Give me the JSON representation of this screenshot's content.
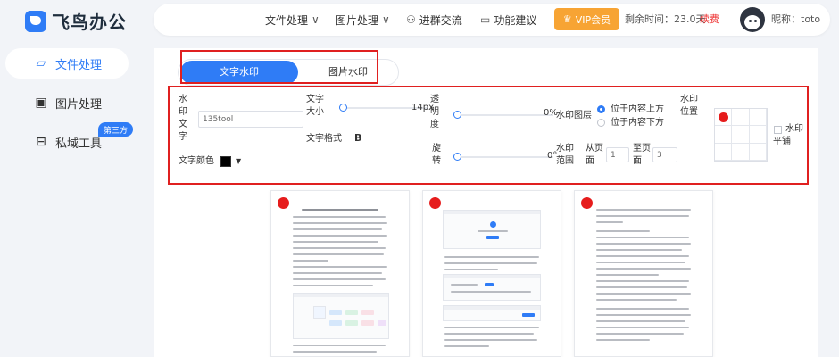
{
  "logo": {
    "text": "飞鸟办公"
  },
  "nav": {
    "file": "文件处理",
    "image": "图片处理",
    "group": "进群交流",
    "feedback": "功能建议",
    "vip": "VIP会员",
    "remain": "剩余时间：23.0天",
    "renew": "续费",
    "nickname": "昵称：toto"
  },
  "sidebar": {
    "items": [
      {
        "label": "文件处理"
      },
      {
        "label": "图片处理"
      },
      {
        "label": "私域工具"
      }
    ],
    "badge": "第三方"
  },
  "tabs": {
    "text": "文字水印",
    "image": "图片水印"
  },
  "settings": {
    "wm_text_label": "水印文字",
    "wm_text_value": "135tool",
    "font_size_label": "文字大小",
    "font_size_value": "14px",
    "transparency_label": "透明度",
    "transparency_value": "0%",
    "layer_label": "水印图层",
    "layer_above": "位于内容上方",
    "layer_below": "位于内容下方",
    "position_label": "水印位置",
    "tile_label": "水印平铺",
    "font_style_label": "文字格式",
    "font_style_value": "B",
    "rotate_label": "旋转",
    "rotate_value": "0°",
    "range_label": "水印范围",
    "from_label": "从页面",
    "from_value": "1",
    "to_label": "至页面",
    "to_value": "3",
    "color_label": "文字颜色",
    "color_value": "#000000"
  },
  "colors": {
    "accent": "#2f7cf6",
    "highlight": "#e02020",
    "vip": "#f7a434",
    "marker": "#e61c1c"
  }
}
